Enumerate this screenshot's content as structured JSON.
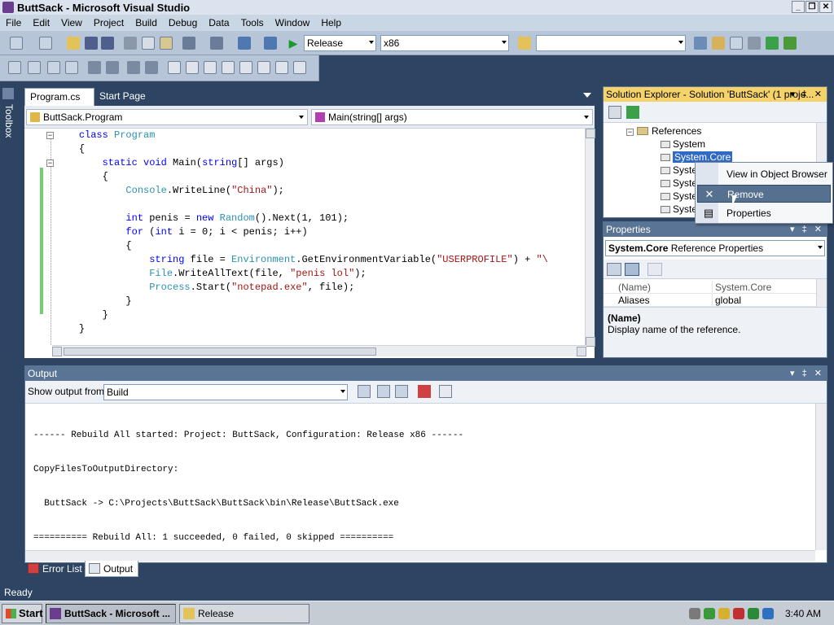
{
  "window": {
    "title": "ButtSack - Microsoft Visual Studio",
    "buttons": [
      "_",
      "❐",
      "✕"
    ]
  },
  "menu": [
    "File",
    "Edit",
    "View",
    "Project",
    "Build",
    "Debug",
    "Data",
    "Tools",
    "Window",
    "Help"
  ],
  "toolbar": {
    "configuration": "Release",
    "platform": "x86",
    "find_value": ""
  },
  "toolbox": {
    "label": "Toolbox"
  },
  "editor": {
    "tabs": [
      {
        "label": "Program.cs",
        "close": "✕"
      },
      {
        "label": "Start Page"
      }
    ],
    "nav_class": "ButtSack.Program",
    "nav_member": "Main(string[] args)",
    "code_lines": [
      {
        "indent": "    ",
        "tokens": [
          {
            "t": "kw",
            "v": "class"
          },
          {
            "t": "",
            "v": " "
          },
          {
            "t": "ty",
            "v": "Program"
          }
        ]
      },
      {
        "indent": "    ",
        "tokens": [
          {
            "t": "",
            "v": "{"
          }
        ]
      },
      {
        "indent": "        ",
        "tokens": [
          {
            "t": "kw",
            "v": "static"
          },
          {
            "t": "",
            "v": " "
          },
          {
            "t": "kw",
            "v": "void"
          },
          {
            "t": "",
            "v": " Main("
          },
          {
            "t": "kw",
            "v": "string"
          },
          {
            "t": "",
            "v": "[] args)"
          }
        ]
      },
      {
        "indent": "        ",
        "tokens": [
          {
            "t": "",
            "v": "{"
          }
        ]
      },
      {
        "indent": "            ",
        "tokens": [
          {
            "t": "ty",
            "v": "Console"
          },
          {
            "t": "",
            "v": ".WriteLine("
          },
          {
            "t": "st",
            "v": "\"China\""
          },
          {
            "t": "",
            "v": ");"
          }
        ]
      },
      {
        "indent": "",
        "tokens": []
      },
      {
        "indent": "            ",
        "tokens": [
          {
            "t": "kw",
            "v": "int"
          },
          {
            "t": "",
            "v": " penis = "
          },
          {
            "t": "kw",
            "v": "new"
          },
          {
            "t": "",
            "v": " "
          },
          {
            "t": "ty",
            "v": "Random"
          },
          {
            "t": "",
            "v": "().Next(1, 101);"
          }
        ]
      },
      {
        "indent": "            ",
        "tokens": [
          {
            "t": "kw",
            "v": "for"
          },
          {
            "t": "",
            "v": " ("
          },
          {
            "t": "kw",
            "v": "int"
          },
          {
            "t": "",
            "v": " i = 0; i < penis; i++)"
          }
        ]
      },
      {
        "indent": "            ",
        "tokens": [
          {
            "t": "",
            "v": "{"
          }
        ]
      },
      {
        "indent": "                ",
        "tokens": [
          {
            "t": "kw",
            "v": "string"
          },
          {
            "t": "",
            "v": " file = "
          },
          {
            "t": "ty",
            "v": "Environment"
          },
          {
            "t": "",
            "v": ".GetEnvironmentVariable("
          },
          {
            "t": "st",
            "v": "\"USERPROFILE\""
          },
          {
            "t": "",
            "v": ") + "
          },
          {
            "t": "st",
            "v": "\"\\"
          }
        ]
      },
      {
        "indent": "                ",
        "tokens": [
          {
            "t": "ty",
            "v": "File"
          },
          {
            "t": "",
            "v": ".WriteAllText(file, "
          },
          {
            "t": "st",
            "v": "\"penis lol\""
          },
          {
            "t": "",
            "v": ");"
          }
        ]
      },
      {
        "indent": "                ",
        "tokens": [
          {
            "t": "ty",
            "v": "Process"
          },
          {
            "t": "",
            "v": ".Start("
          },
          {
            "t": "st",
            "v": "\"notepad.exe\""
          },
          {
            "t": "",
            "v": ", file);"
          }
        ]
      },
      {
        "indent": "            ",
        "tokens": [
          {
            "t": "",
            "v": "}"
          }
        ]
      },
      {
        "indent": "        ",
        "tokens": [
          {
            "t": "",
            "v": "}"
          }
        ]
      },
      {
        "indent": "    ",
        "tokens": [
          {
            "t": "",
            "v": "}"
          }
        ]
      }
    ]
  },
  "solution_explorer": {
    "title": "Solution Explorer - Solution 'ButtSack' (1 proje...",
    "header_buttons": "▾ ‡ ✕",
    "tree": [
      {
        "label": "References",
        "kind": "folder"
      },
      {
        "label": "System",
        "kind": "ref"
      },
      {
        "label": "System.Core",
        "kind": "ref",
        "selected": true
      },
      {
        "label": "Syste",
        "kind": "ref"
      },
      {
        "label": "Syste",
        "kind": "ref"
      },
      {
        "label": "Syste",
        "kind": "ref"
      },
      {
        "label": "Syste",
        "kind": "ref"
      }
    ]
  },
  "context_menu": {
    "items": [
      {
        "label": "View in Object Browser",
        "icon": ""
      },
      {
        "label": "Remove",
        "icon": "✕",
        "hover": true
      },
      {
        "label": "Properties",
        "icon": "▤"
      }
    ]
  },
  "properties": {
    "title": "Properties",
    "object_name": "System.Core",
    "object_type": "Reference Properties",
    "rows": [
      {
        "name": "(Name)",
        "value": "System.Core"
      },
      {
        "name": "Aliases",
        "value": "global"
      }
    ],
    "desc_title": "(Name)",
    "desc_text": "Display name of the reference."
  },
  "output": {
    "title": "Output",
    "show_from_label": "Show output from:",
    "show_from_value": "Build",
    "lines": [
      "------ Rebuild All started: Project: ButtSack, Configuration: Release x86 ------",
      "CopyFilesToOutputDirectory:",
      "  ButtSack -> C:\\Projects\\ButtSack\\ButtSack\\bin\\Release\\ButtSack.exe",
      "========== Rebuild All: 1 succeeded, 0 failed, 0 skipped =========="
    ]
  },
  "bottom_tabs": [
    {
      "label": "Error List"
    },
    {
      "label": "Output",
      "active": true
    }
  ],
  "status": {
    "text": "Ready"
  },
  "taskbar": {
    "start_label": "Start",
    "tasks": [
      {
        "label": "ButtSack - Microsoft ...",
        "active": true
      },
      {
        "label": "Release",
        "active": false
      }
    ],
    "clock": "3:40 AM"
  },
  "colors": {
    "selection": "#316ac5",
    "keyword": "#0000ff",
    "type": "#2b91af",
    "string": "#a31515",
    "changed_margin": "#6ed06e"
  }
}
